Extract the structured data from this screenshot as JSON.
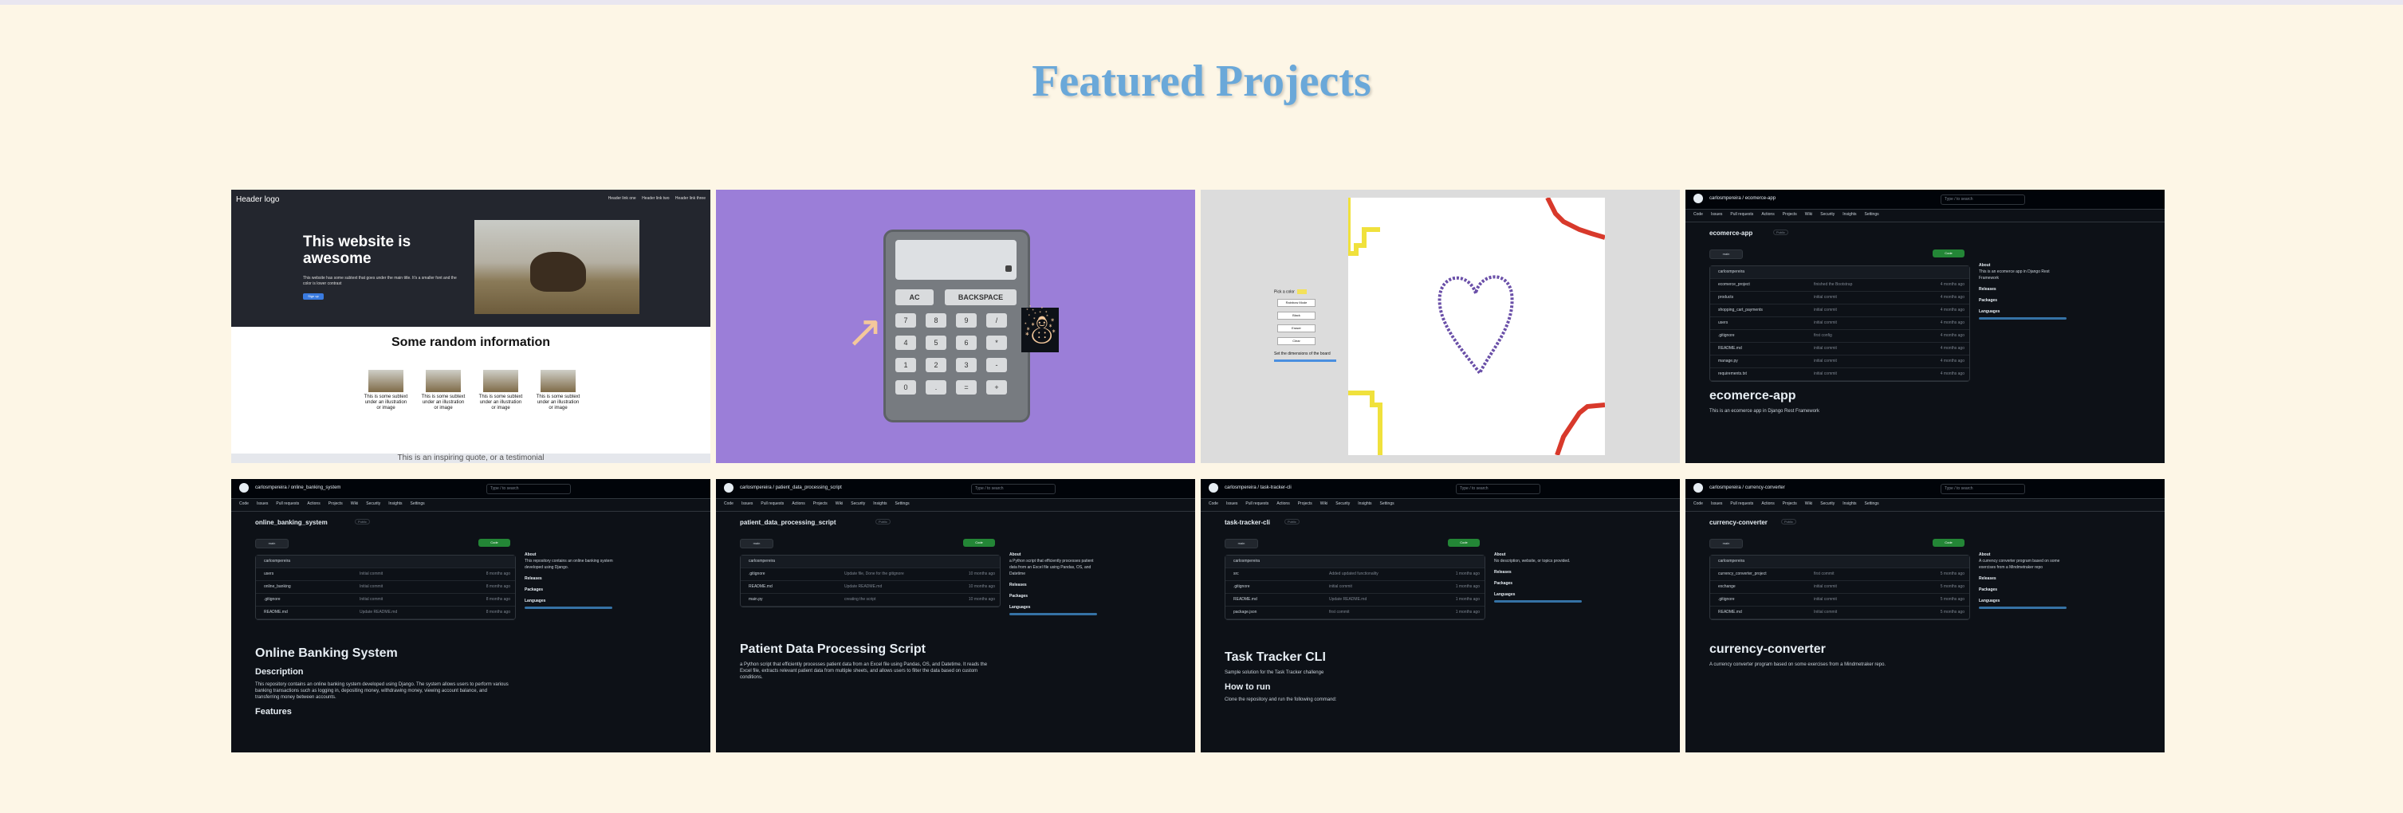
{
  "page": {
    "title": "Featured Projects"
  },
  "projects": [
    {
      "kind": "website",
      "logo": "Header logo",
      "links": [
        "Header link one",
        "Header link two",
        "Header link three"
      ],
      "hero_title": "This website is awesome",
      "hero_text": "This website has some subtext that goes under the main title. It's a smaller font and the color is lower contrast",
      "hero_button": "Sign up",
      "section_title": "Some random information",
      "captions": [
        "This is some subtext under an illustration or image",
        "This is some subtext under an illustration or image",
        "This is some subtext under an illustration or image",
        "This is some subtext under an illustration or image"
      ],
      "footer_text": "This is an inspiring quote, or a testimonial"
    },
    {
      "kind": "calculator",
      "keys_wide": [
        "AC",
        "BACKSPACE"
      ],
      "keys": [
        "7",
        "8",
        "9",
        "/",
        "4",
        "5",
        "6",
        "*",
        "1",
        "2",
        "3",
        "-",
        "0",
        ".",
        "=",
        "+"
      ],
      "link_icon": "external-link-icon",
      "repo_icon": "github-icon"
    },
    {
      "kind": "etch-a-sketch",
      "pick_color": "Pick a color",
      "buttons": [
        "Rainbow Mode",
        "Black",
        "Eraser",
        "Clear"
      ],
      "size_label": "Set the dimensions of the board"
    },
    {
      "kind": "github",
      "owner": "carlosmpereira",
      "repo": "ecomerce-app",
      "branch": "main",
      "files": [
        {
          "name": "ecomerce_project",
          "msg": "finished the Bootstrap",
          "time": "4 months ago"
        },
        {
          "name": "products",
          "msg": "initial commit",
          "time": "4 months ago"
        },
        {
          "name": "shopping_cart_payments",
          "msg": "initial commit",
          "time": "4 months ago"
        },
        {
          "name": "users",
          "msg": "initial commit",
          "time": "4 months ago"
        },
        {
          "name": ".gitignore",
          "msg": "first config",
          "time": "4 months ago"
        },
        {
          "name": "README.md",
          "msg": "initial commit",
          "time": "4 months ago"
        },
        {
          "name": "manage.py",
          "msg": "initial commit",
          "time": "4 months ago"
        },
        {
          "name": "requirements.txt",
          "msg": "initial commit",
          "time": "4 months ago"
        }
      ],
      "about": "This is an ecomerce app in Django Rest Framework",
      "readme_title": "ecomerce-app",
      "readme_desc": "This is an ecomerce app in Django Rest Framework"
    },
    {
      "kind": "github",
      "owner": "carlosmpereira",
      "repo": "online_banking_system",
      "branch": "main",
      "files": [
        {
          "name": "users",
          "msg": "Initial commit",
          "time": "8 months ago"
        },
        {
          "name": "online_banking",
          "msg": "Initial commit",
          "time": "8 months ago"
        },
        {
          "name": ".gitignore",
          "msg": "Initial commit",
          "time": "8 months ago"
        },
        {
          "name": "README.md",
          "msg": "Update README.md",
          "time": "8 months ago"
        }
      ],
      "about": "This repository contains an online banking system developed using Django.",
      "readme_title": "Online Banking System",
      "readme_h2": "Description",
      "readme_desc": "This repository contains an online banking system developed using Django. The system allows users to perform various banking transactions such as logging in, depositing money, withdrawing money, viewing account balance, and transferring money between accounts.",
      "readme_h3": "Features"
    },
    {
      "kind": "github",
      "owner": "carlosmpereira",
      "repo": "patient_data_processing_script",
      "branch": "main",
      "files": [
        {
          "name": ".gitignore",
          "msg": "Update file, Done for the gitignore",
          "time": "10 months ago"
        },
        {
          "name": "README.md",
          "msg": "Update README.md",
          "time": "10 months ago"
        },
        {
          "name": "main.py",
          "msg": "creating the script",
          "time": "10 months ago"
        }
      ],
      "about": "a Python script that efficiently processes patient data from an Excel file using Pandas, OS, and Datetime",
      "readme_title": "Patient Data Processing Script",
      "readme_desc": "a Python script that efficiently processes patient data from an Excel file using Pandas, OS, and Datetime. It reads the Excel file, extracts relevant patient data from multiple sheets, and allows users to filter the data based on custom conditions."
    },
    {
      "kind": "github",
      "owner": "carlosmpereira",
      "repo": "task-tracker-cli",
      "branch": "main",
      "files": [
        {
          "name": "src",
          "msg": "Added updated functionality",
          "time": "1 months ago"
        },
        {
          "name": ".gitignore",
          "msg": "initial commit",
          "time": "1 months ago"
        },
        {
          "name": "README.md",
          "msg": "Update README.md",
          "time": "1 months ago"
        },
        {
          "name": "package.json",
          "msg": "first commit",
          "time": "1 months ago"
        }
      ],
      "about": "No description, website, or topics provided.",
      "readme_title": "Task Tracker CLI",
      "readme_desc": "Sample solution for the Task Tracker challenge",
      "readme_h2": "How to run",
      "readme_desc2": "Clone the repository and run the following command:"
    },
    {
      "kind": "github",
      "owner": "carlosmpereira",
      "repo": "currency-converter",
      "branch": "main",
      "files": [
        {
          "name": "currency_converter_project",
          "msg": "first commit",
          "time": "5 months ago"
        },
        {
          "name": "exchange",
          "msg": "initial commit",
          "time": "5 months ago"
        },
        {
          "name": ".gitignore",
          "msg": "initial commit",
          "time": "5 months ago"
        },
        {
          "name": "README.md",
          "msg": "Initial commit",
          "time": "5 months ago"
        }
      ],
      "about": "A currency converter program based on some exercises from a Mindmetraker repo",
      "readme_title": "currency-converter",
      "readme_desc": "A currency converter program based on some exercises from a Mindmetraker repo."
    }
  ],
  "github_ui": {
    "tabs": [
      "Code",
      "Issues",
      "Pull requests",
      "Actions",
      "Projects",
      "Wiki",
      "Security",
      "Insights",
      "Settings"
    ],
    "search": "Type / to search",
    "public": "Public",
    "code_button": "Code",
    "about": "About",
    "releases": "Releases",
    "packages": "Packages",
    "languages": "Languages",
    "readme": "README"
  }
}
